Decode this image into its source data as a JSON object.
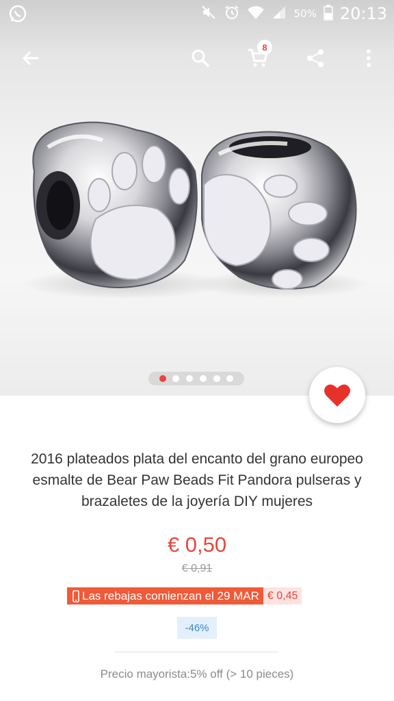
{
  "status_bar": {
    "battery_percent": "50%",
    "time": "20:13",
    "icons": [
      "whatsapp-icon",
      "mute-icon",
      "alarm-icon",
      "wifi-icon",
      "signal-icon",
      "battery-icon"
    ]
  },
  "toolbar": {
    "icons": [
      "back-arrow-icon",
      "search-icon",
      "cart-icon",
      "share-icon",
      "more-vertical-icon"
    ],
    "cart_count": "8"
  },
  "carousel": {
    "total_images": 6,
    "active_index": 0
  },
  "product": {
    "title": "2016 plateados plata del encanto del grano europeo esmalte de Bear Paw Beads Fit Pandora pulseras y brazaletes de la joyería DIY mujeres",
    "price": "€ 0,50",
    "original_price": "€ 0,91",
    "sale_banner": "Las rebajas comienzan el 29 MAR",
    "sale_price": "€ 0,45",
    "discount": "-46%",
    "wholesale": "Precio mayorista:5% off (> 10 pieces)"
  },
  "colors": {
    "accent": "#e6473a",
    "sale_banner_bg": "#f05a38",
    "discount_text": "#3b87c9"
  }
}
